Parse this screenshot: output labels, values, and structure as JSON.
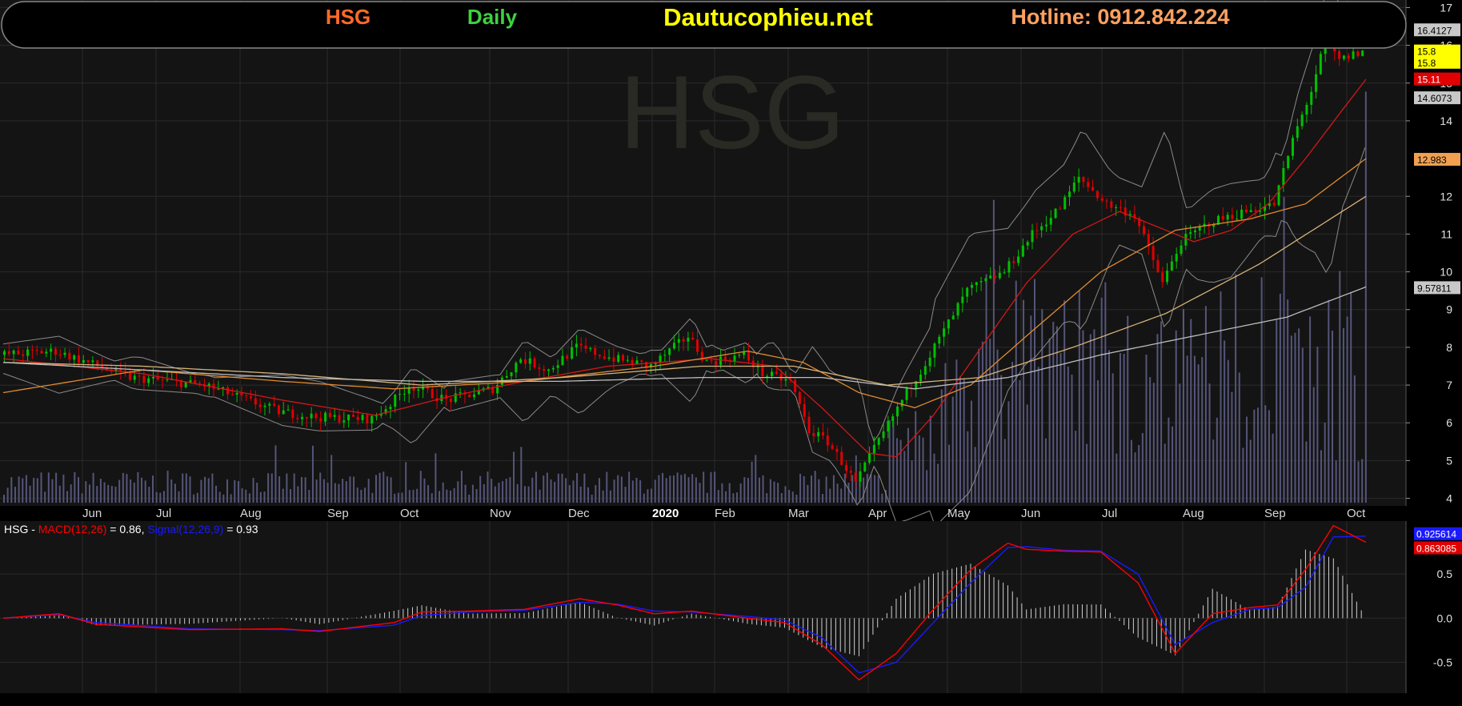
{
  "header": {
    "ticker": "HSG",
    "timeframe": "Daily",
    "site": "Dautucophieu.net",
    "hotline": "Hotline: 0912.842.224"
  },
  "watermark": "HSG",
  "colors": {
    "background": "#000000",
    "panel": "#141414",
    "grid": "#2a2a2a",
    "up": "#00c000",
    "down": "#e00000",
    "ma_red": "#d01818",
    "ma_orange": "#e08a30",
    "ma_tan": "#d6b27a",
    "ma_white": "#bdbdbd",
    "band": "#8a8a8a",
    "volume": "#55557a",
    "macd": "#ff0000",
    "signal": "#1a1aff",
    "ticker_color": "#ff6a2a",
    "daily_color": "#3fd13f",
    "site_color": "#ffff00",
    "hotline_color": "#ffa060"
  },
  "chart_data": [
    {
      "type": "candlestick",
      "title": "HSG",
      "x_labels": [
        "Jun",
        "Jul",
        "Aug",
        "Sep",
        "Oct",
        "Nov",
        "Dec",
        "2020",
        "Feb",
        "Mar",
        "Apr",
        "May",
        "Jun",
        "Jul",
        "Aug",
        "Sep",
        "Oct"
      ],
      "y_ticks": [
        4,
        5,
        6,
        7,
        8,
        9,
        10,
        11,
        12,
        14,
        15,
        16,
        17
      ],
      "ylim": [
        3.8,
        17.2
      ],
      "grid": true,
      "price_markers": [
        {
          "value": "16.4127",
          "y": 16.41,
          "bg": "#c8c8c8",
          "fg": "#000000"
        },
        {
          "value": "15.8",
          "y": 15.85,
          "bg": "#ffff00",
          "fg": "#000000"
        },
        {
          "value": "15.8",
          "y": 15.55,
          "bg": "#ffff00",
          "fg": "#000000"
        },
        {
          "value": "15.11",
          "y": 15.11,
          "bg": "#e00000",
          "fg": "#ffffff"
        },
        {
          "value": "14.6073",
          "y": 14.61,
          "bg": "#c8c8c8",
          "fg": "#000000"
        },
        {
          "value": "12.983",
          "y": 12.98,
          "bg": "#f0a050",
          "fg": "#000000"
        },
        {
          "value": "9.57811",
          "y": 9.58,
          "bg": "#c8c8c8",
          "fg": "#000000"
        }
      ],
      "series": [
        {
          "name": "Close (key points)",
          "values": [
            [
              0,
              7.8
            ],
            [
              60,
              7.9
            ],
            [
              140,
              7.2
            ],
            [
              220,
              7.0
            ],
            [
              300,
              6.3
            ],
            [
              340,
              6.15
            ],
            [
              400,
              6.1
            ],
            [
              420,
              6.5
            ],
            [
              440,
              7.0
            ],
            [
              480,
              6.6
            ],
            [
              530,
              6.9
            ],
            [
              560,
              7.7
            ],
            [
              590,
              7.4
            ],
            [
              620,
              8.0
            ],
            [
              660,
              7.7
            ],
            [
              700,
              7.5
            ],
            [
              720,
              7.9
            ],
            [
              740,
              8.3
            ],
            [
              760,
              7.6
            ],
            [
              800,
              7.8
            ],
            [
              820,
              7.3
            ],
            [
              850,
              7.1
            ],
            [
              870,
              5.8
            ],
            [
              890,
              5.5
            ],
            [
              910,
              4.8
            ],
            [
              920,
              4.4
            ],
            [
              940,
              5.3
            ],
            [
              970,
              6.6
            ],
            [
              1000,
              7.8
            ],
            [
              1040,
              9.5
            ],
            [
              1080,
              10.0
            ],
            [
              1110,
              11.0
            ],
            [
              1140,
              11.7
            ],
            [
              1160,
              12.5
            ],
            [
              1190,
              11.8
            ],
            [
              1220,
              11.5
            ],
            [
              1250,
              9.7
            ],
            [
              1270,
              10.8
            ],
            [
              1300,
              11.3
            ],
            [
              1340,
              11.6
            ],
            [
              1370,
              11.8
            ],
            [
              1390,
              13.5
            ],
            [
              1410,
              14.8
            ],
            [
              1425,
              16.1
            ],
            [
              1440,
              15.6
            ],
            [
              1460,
              15.8
            ]
          ]
        },
        {
          "name": "MA red (20)",
          "values": [
            [
              0,
              7.7
            ],
            [
              150,
              7.3
            ],
            [
              300,
              6.6
            ],
            [
              400,
              6.2
            ],
            [
              480,
              6.7
            ],
            [
              560,
              7.1
            ],
            [
              650,
              7.5
            ],
            [
              760,
              7.7
            ],
            [
              830,
              7.5
            ],
            [
              880,
              6.4
            ],
            [
              930,
              5.2
            ],
            [
              960,
              5.1
            ],
            [
              1000,
              6.2
            ],
            [
              1040,
              7.6
            ],
            [
              1100,
              9.7
            ],
            [
              1150,
              11.0
            ],
            [
              1200,
              11.6
            ],
            [
              1240,
              11.2
            ],
            [
              1280,
              10.8
            ],
            [
              1320,
              11.1
            ],
            [
              1360,
              11.8
            ],
            [
              1400,
              13.0
            ],
            [
              1440,
              14.3
            ],
            [
              1465,
              15.1
            ]
          ]
        },
        {
          "name": "MA orange (50)",
          "values": [
            [
              0,
              6.8
            ],
            [
              150,
              7.4
            ],
            [
              300,
              7.1
            ],
            [
              420,
              6.9
            ],
            [
              560,
              7.1
            ],
            [
              700,
              7.5
            ],
            [
              800,
              7.9
            ],
            [
              860,
              7.6
            ],
            [
              920,
              6.8
            ],
            [
              980,
              6.4
            ],
            [
              1040,
              7.0
            ],
            [
              1100,
              8.3
            ],
            [
              1180,
              10.0
            ],
            [
              1260,
              11.1
            ],
            [
              1340,
              11.4
            ],
            [
              1400,
              11.8
            ],
            [
              1465,
              13.0
            ]
          ]
        },
        {
          "name": "MA tan (100)",
          "values": [
            [
              0,
              7.6
            ],
            [
              150,
              7.5
            ],
            [
              300,
              7.3
            ],
            [
              450,
              7.0
            ],
            [
              600,
              7.2
            ],
            [
              750,
              7.5
            ],
            [
              850,
              7.5
            ],
            [
              950,
              7.0
            ],
            [
              1050,
              7.2
            ],
            [
              1150,
              8.0
            ],
            [
              1250,
              8.9
            ],
            [
              1350,
              10.2
            ],
            [
              1465,
              12.0
            ]
          ]
        },
        {
          "name": "MA white (200)",
          "values": [
            [
              0,
              7.6
            ],
            [
              150,
              7.4
            ],
            [
              300,
              7.2
            ],
            [
              450,
              7.1
            ],
            [
              600,
              7.1
            ],
            [
              750,
              7.2
            ],
            [
              880,
              7.2
            ],
            [
              980,
              6.9
            ],
            [
              1080,
              7.2
            ],
            [
              1180,
              7.8
            ],
            [
              1280,
              8.3
            ],
            [
              1380,
              8.8
            ],
            [
              1465,
              9.6
            ]
          ]
        }
      ]
    },
    {
      "type": "line",
      "title": "HSG - MACD(12,26) = 0.86, Signal(12,26,9) = 0.93",
      "legend": {
        "prefix": "HSG - ",
        "macd_label": "MACD(12,26)",
        "macd_value": " = 0.86, ",
        "signal_label": "Signal(12,26,9)",
        "signal_value": " = 0.93"
      },
      "y_ticks": [
        -0.5,
        0.0,
        0.5
      ],
      "y_tick_labels": [
        "-0.5",
        "0.0",
        "0.5"
      ],
      "ylim": [
        -0.85,
        1.1
      ],
      "value_markers": [
        {
          "value": "0.925614",
          "y": 0.93,
          "bg": "#1a1aff",
          "fg": "#ffffff"
        },
        {
          "value": "0.863085",
          "y": 0.86,
          "bg": "#e00000",
          "fg": "#ffffff"
        }
      ],
      "series": [
        {
          "name": "MACD(12,26)",
          "values": [
            [
              0,
              0.0
            ],
            [
              60,
              0.05
            ],
            [
              100,
              -0.07
            ],
            [
              200,
              -0.13
            ],
            [
              300,
              -0.12
            ],
            [
              340,
              -0.15
            ],
            [
              420,
              -0.05
            ],
            [
              450,
              0.07
            ],
            [
              500,
              0.08
            ],
            [
              560,
              0.1
            ],
            [
              620,
              0.22
            ],
            [
              660,
              0.15
            ],
            [
              700,
              0.05
            ],
            [
              740,
              0.08
            ],
            [
              800,
              0.0
            ],
            [
              840,
              -0.05
            ],
            [
              880,
              -0.3
            ],
            [
              920,
              -0.7
            ],
            [
              960,
              -0.4
            ],
            [
              1000,
              0.1
            ],
            [
              1040,
              0.55
            ],
            [
              1080,
              0.85
            ],
            [
              1100,
              0.78
            ],
            [
              1140,
              0.76
            ],
            [
              1180,
              0.75
            ],
            [
              1220,
              0.4
            ],
            [
              1260,
              -0.4
            ],
            [
              1300,
              0.05
            ],
            [
              1340,
              0.12
            ],
            [
              1370,
              0.15
            ],
            [
              1400,
              0.55
            ],
            [
              1430,
              1.05
            ],
            [
              1465,
              0.86
            ]
          ]
        },
        {
          "name": "Signal(12,26,9)",
          "values": [
            [
              0,
              0.0
            ],
            [
              60,
              0.04
            ],
            [
              100,
              -0.05
            ],
            [
              200,
              -0.12
            ],
            [
              300,
              -0.13
            ],
            [
              340,
              -0.14
            ],
            [
              420,
              -0.08
            ],
            [
              450,
              0.03
            ],
            [
              500,
              0.07
            ],
            [
              560,
              0.09
            ],
            [
              620,
              0.18
            ],
            [
              660,
              0.16
            ],
            [
              700,
              0.08
            ],
            [
              740,
              0.07
            ],
            [
              800,
              0.02
            ],
            [
              840,
              -0.02
            ],
            [
              880,
              -0.22
            ],
            [
              920,
              -0.62
            ],
            [
              960,
              -0.5
            ],
            [
              1000,
              -0.05
            ],
            [
              1040,
              0.4
            ],
            [
              1080,
              0.8
            ],
            [
              1100,
              0.81
            ],
            [
              1140,
              0.77
            ],
            [
              1180,
              0.76
            ],
            [
              1220,
              0.5
            ],
            [
              1260,
              -0.3
            ],
            [
              1300,
              -0.05
            ],
            [
              1340,
              0.1
            ],
            [
              1370,
              0.12
            ],
            [
              1400,
              0.35
            ],
            [
              1430,
              0.92
            ],
            [
              1465,
              0.93
            ]
          ]
        }
      ]
    }
  ]
}
